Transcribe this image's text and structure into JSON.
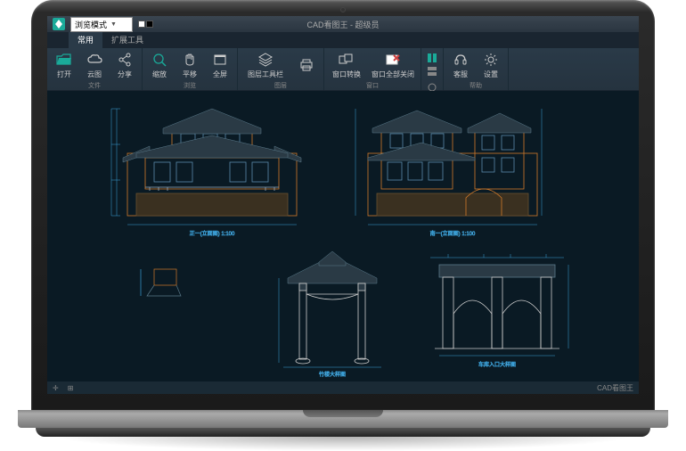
{
  "title": "CAD看图王 - 超级员",
  "mode_label": "浏览模式",
  "tabs": {
    "common": "常用",
    "extend": "扩展工具"
  },
  "ribbon": {
    "file": {
      "label": "文件",
      "open": "打开",
      "cloud": "云图",
      "share": "分享"
    },
    "view": {
      "label": "浏览",
      "zoom": "缩放",
      "pan": "平移",
      "fullscreen": "全屏"
    },
    "layer": {
      "label": "图层",
      "toolbar": "图层工具栏"
    },
    "window": {
      "label": "窗口",
      "switch": "窗口转换",
      "closeall": "窗口全部关闭"
    },
    "help": {
      "label": "帮助",
      "service": "客服",
      "settings": "设置"
    }
  },
  "drawing": {
    "label_front": "正一(立面图) 1:100",
    "label_side": "南一(立面图) 1:100",
    "label_gate_left": "竹楼大样图",
    "label_gate_right": "车库入口大样图"
  },
  "statusbar": {
    "brand": "CAD看图王"
  },
  "colors": {
    "accent": "#1aaa99",
    "wall": "#d17a2a",
    "roof": "#5a7a8a",
    "dim": "#3aa0d8"
  }
}
